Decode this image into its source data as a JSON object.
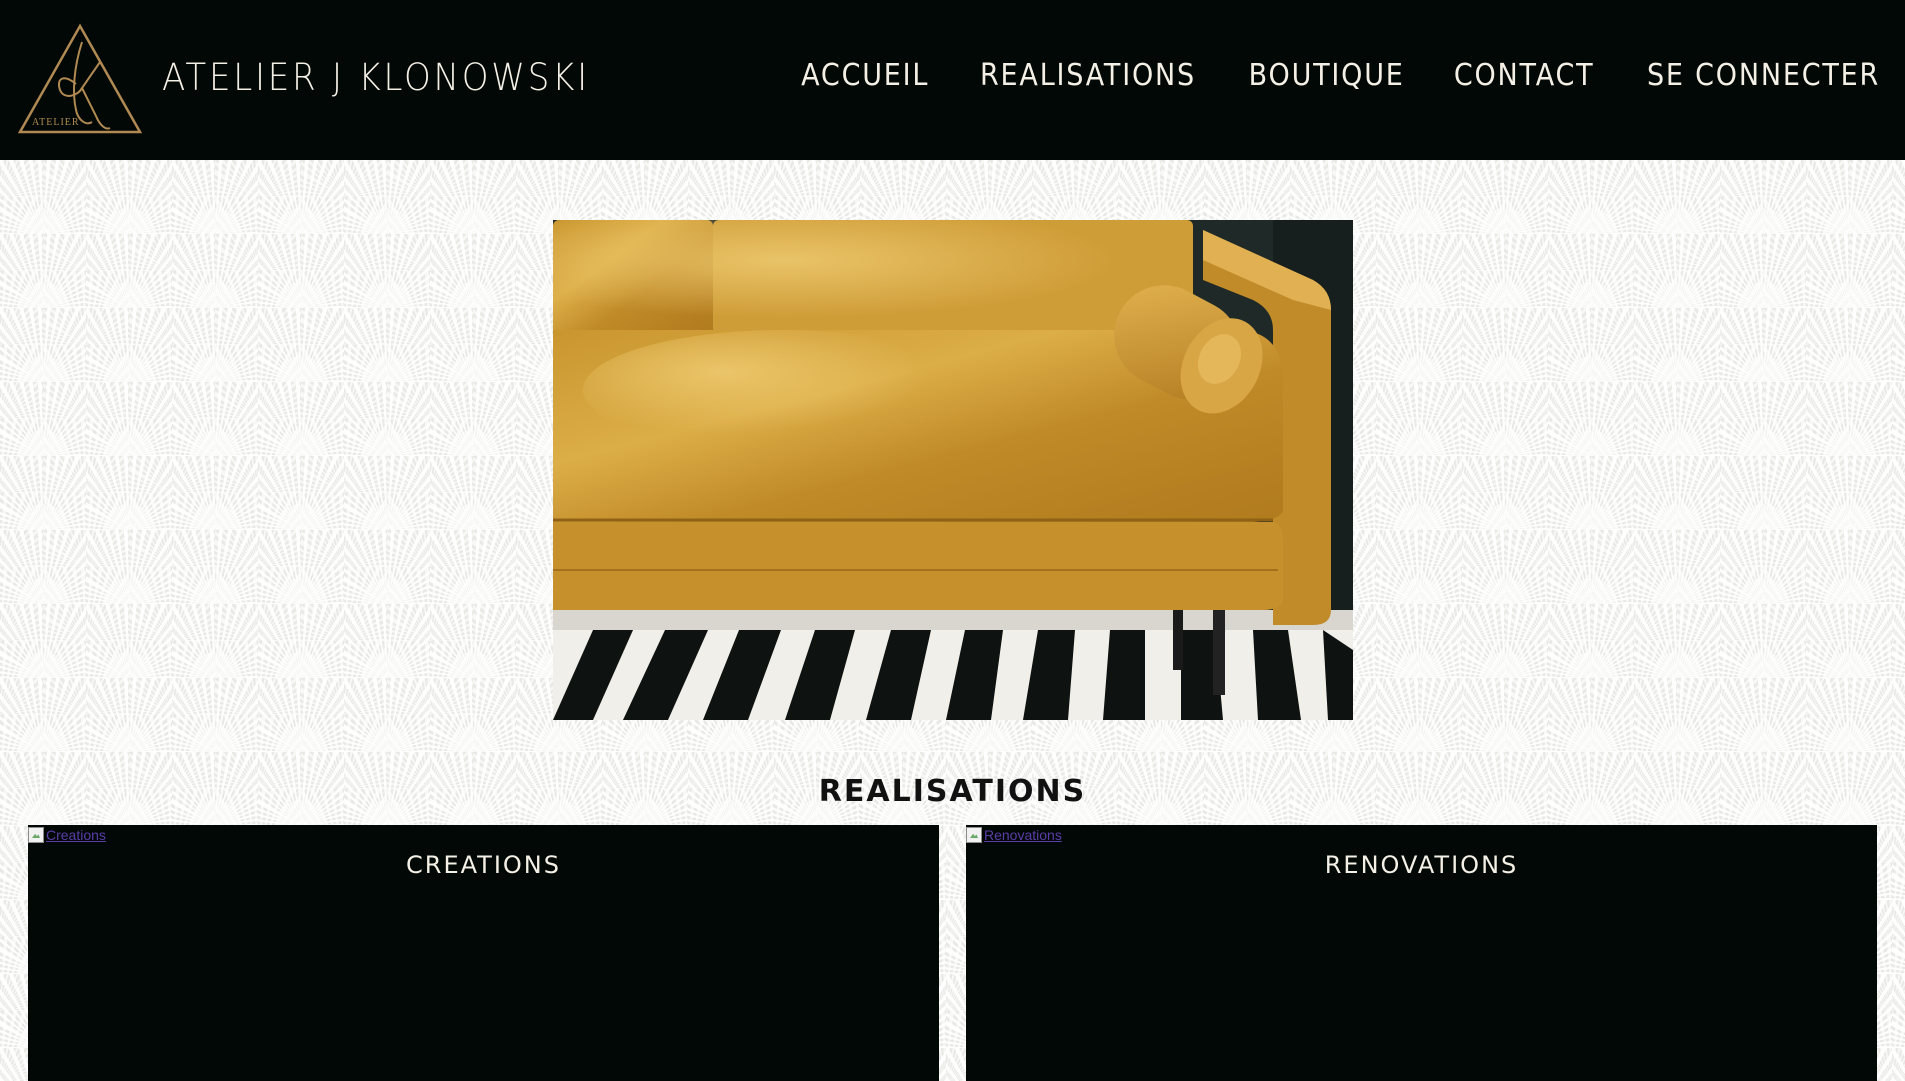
{
  "header": {
    "logo_text": "ATELIER",
    "site_title": "ATELIER J KLONOWSKI",
    "nav": [
      {
        "label": "ACCUEIL"
      },
      {
        "label": "REALISATIONS"
      },
      {
        "label": "BOUTIQUE"
      },
      {
        "label": "CONTACT"
      },
      {
        "label": "SE CONNECTER"
      }
    ]
  },
  "colors": {
    "header_bg": "#020805",
    "text_light": "#f5f0e6",
    "logo_gold": "#b08a52",
    "sofa_gold": "#d6a43a"
  },
  "hero": {
    "subject": "gold-velvet-sofa-on-striped-rug"
  },
  "main": {
    "section_title": "REALISATIONS",
    "cards": [
      {
        "alt": "Creations",
        "title": "CREATIONS"
      },
      {
        "alt": "Renovations",
        "title": "RENOVATIONS"
      }
    ]
  }
}
